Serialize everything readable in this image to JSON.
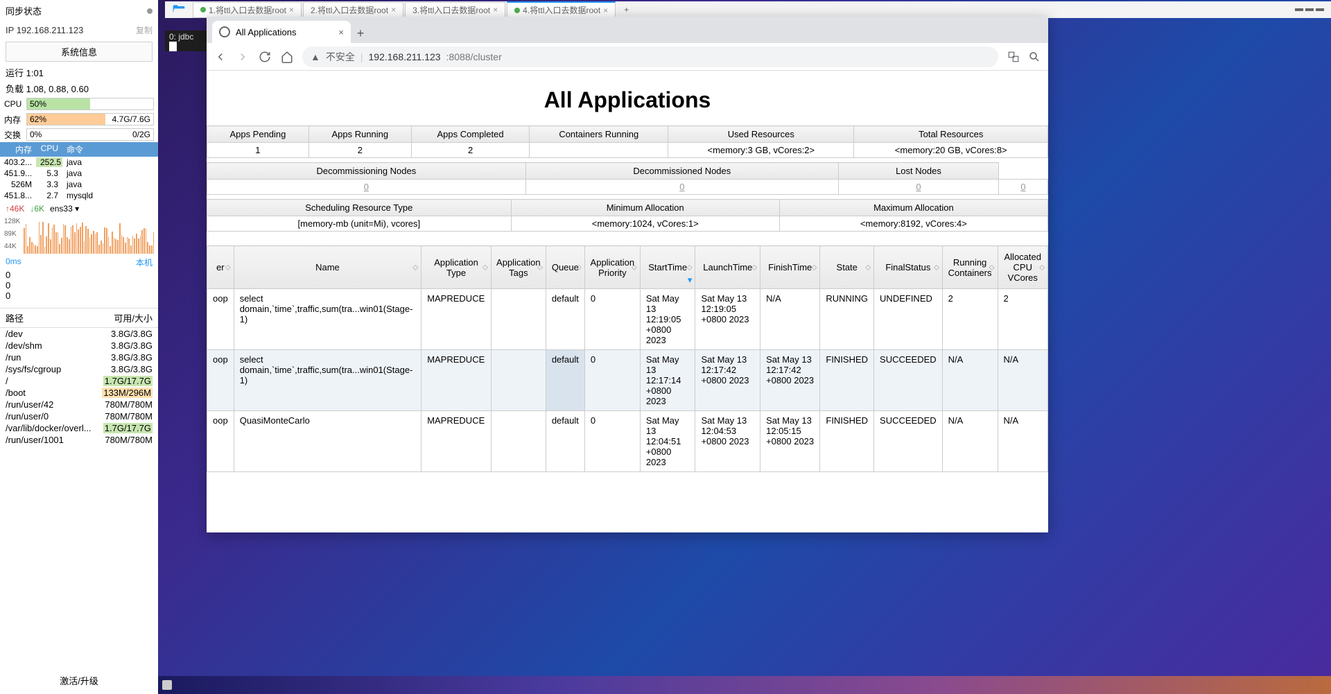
{
  "sysmon": {
    "sync_status": "同步状态",
    "ip_label": "IP",
    "ip_value": "192.168.211.123",
    "copy": "复制",
    "sysinfo_btn": "系统信息",
    "uptime": "运行 1:01",
    "load": "负载 1.08, 0.88, 0.60",
    "cpu_label": "CPU",
    "cpu_pct": "50%",
    "mem_label": "内存",
    "mem_pct": "62%",
    "mem_detail": "4.7G/7.6G",
    "swap_label": "交换",
    "swap_pct": "0%",
    "swap_detail": "0/2G",
    "proc_h_mem": "内存",
    "proc_h_cpu": "CPU",
    "proc_h_cmd": "命令",
    "procs": [
      {
        "mem": "403.2...",
        "cpu": "252.5",
        "cmd": "java",
        "hl": true
      },
      {
        "mem": "451.9...",
        "cpu": "5.3",
        "cmd": "java"
      },
      {
        "mem": "526M",
        "cpu": "3.3",
        "cmd": "java"
      },
      {
        "mem": "451.8...",
        "cpu": "2.7",
        "cmd": "mysqld"
      }
    ],
    "net_up": "46K",
    "net_down": "6K",
    "net_if": "ens33",
    "chart_top": "128K",
    "chart_mid": "89K",
    "chart_low": "44K",
    "ping": "0ms",
    "ping_host": "本机",
    "zeros": [
      "0",
      "0",
      "0"
    ],
    "fs_h_path": "路径",
    "fs_h_size": "可用/大小",
    "fs": [
      {
        "path": "/dev",
        "size": "3.8G/3.8G"
      },
      {
        "path": "/dev/shm",
        "size": "3.8G/3.8G"
      },
      {
        "path": "/run",
        "size": "3.8G/3.8G"
      },
      {
        "path": "/sys/fs/cgroup",
        "size": "3.8G/3.8G"
      },
      {
        "path": "/",
        "size": "1.7G/17.7G",
        "hl": true
      },
      {
        "path": "/boot",
        "size": "133M/296M",
        "warn": true
      },
      {
        "path": "/run/user/42",
        "size": "780M/780M"
      },
      {
        "path": "/run/user/0",
        "size": "780M/780M"
      },
      {
        "path": "/var/lib/docker/overl...",
        "size": "1.7G/17.7G",
        "hl": true
      },
      {
        "path": "/run/user/1001",
        "size": "780M/780M"
      }
    ],
    "activate": "激活/升级"
  },
  "ide_tabs": [
    "1.将ttl入口去数据root",
    "2.将ttl入口去数据root",
    "3.将ttl入口去数据root",
    "4.将ttl入口去数据root"
  ],
  "term": "0: jdbc",
  "browser": {
    "tab_title": "All Applications",
    "insecure": "不安全",
    "url_host": "192.168.211.123",
    "url_port_path": ":8088/cluster"
  },
  "yarn": {
    "title": "All Applications",
    "metrics1_h": [
      "Apps Pending",
      "Apps Running",
      "Apps Completed",
      "Containers Running",
      "Used Resources",
      "Total Resources"
    ],
    "metrics1_v": [
      "1",
      "2",
      "2",
      "",
      "<memory:3 GB, vCores:2>",
      "<memory:20 GB, vCores:8>"
    ],
    "metrics2_h": [
      "Decommissioning Nodes",
      "Decommissioned Nodes",
      "Lost Nodes"
    ],
    "metrics2_v": [
      "0",
      "0",
      "0",
      "0"
    ],
    "metrics3_h": [
      "Scheduling Resource Type",
      "Minimum Allocation",
      "Maximum Allocation"
    ],
    "metrics3_v": [
      "[memory-mb (unit=Mi), vcores]",
      "<memory:1024, vCores:1>",
      "<memory:8192, vCores:4>"
    ],
    "apps_h": [
      "er",
      "Name",
      "Application Type",
      "Application Tags",
      "Queue",
      "Application Priority",
      "StartTime",
      "LaunchTime",
      "FinishTime",
      "State",
      "FinalStatus",
      "Running Containers",
      "Allocated CPU VCores"
    ],
    "apps": [
      {
        "user": "oop",
        "name": "select domain,`time`,traffic,sum(tra...win01(Stage-1)",
        "type": "MAPREDUCE",
        "tags": "",
        "queue": "default",
        "prio": "0",
        "start": "Sat May 13 12:19:05 +0800 2023",
        "launch": "Sat May 13 12:19:05 +0800 2023",
        "finish": "N/A",
        "state": "RUNNING",
        "final": "UNDEFINED",
        "rc": "2",
        "cpu": "2"
      },
      {
        "user": "oop",
        "name": "select domain,`time`,traffic,sum(tra...win01(Stage-1)",
        "type": "MAPREDUCE",
        "tags": "",
        "queue": "default",
        "prio": "0",
        "start": "Sat May 13 12:17:14 +0800 2023",
        "launch": "Sat May 13 12:17:42 +0800 2023",
        "finish": "Sat May 13 12:17:42 +0800 2023",
        "state": "FINISHED",
        "final": "SUCCEEDED",
        "rc": "N/A",
        "cpu": "N/A"
      },
      {
        "user": "oop",
        "name": "QuasiMonteCarlo",
        "type": "MAPREDUCE",
        "tags": "",
        "queue": "default",
        "prio": "0",
        "start": "Sat May 13 12:04:51 +0800 2023",
        "launch": "Sat May 13 12:04:53 +0800 2023",
        "finish": "Sat May 13 12:05:15 +0800 2023",
        "state": "FINISHED",
        "final": "SUCCEEDED",
        "rc": "N/A",
        "cpu": "N/A"
      }
    ]
  }
}
